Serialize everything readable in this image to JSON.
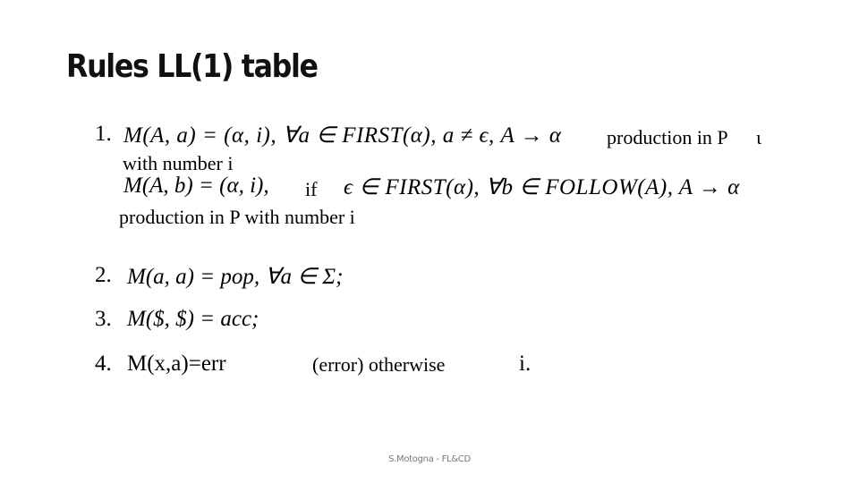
{
  "slide": {
    "title": "Rules LL(1) table",
    "footer": "S.Motogna - FL&CD"
  },
  "rules": [
    {
      "number": "1.",
      "formula": "M(A, a) = (α, i), ∀a ∈ FIRST(α), a ≠ ϵ, A → α",
      "suffix": "production in P",
      "stray_char": "ι",
      "continuation": "with number i"
    },
    {
      "number": "",
      "formula_left": "M(A, b) = (α, i),",
      "condition_word": "if",
      "formula_right": "ϵ ∈ FIRST(α), ∀b ∈ FOLLOW(A), A → α",
      "continuation": "production in P with number i"
    },
    {
      "number": "2.",
      "formula": "M(a, a) = pop, ∀a ∈ Σ;"
    },
    {
      "number": "3.",
      "formula": "M($, $) = acc;"
    },
    {
      "number": "4.",
      "formula": "M(x,a)=err",
      "description": "(error) otherwise",
      "trailing": "i."
    }
  ]
}
